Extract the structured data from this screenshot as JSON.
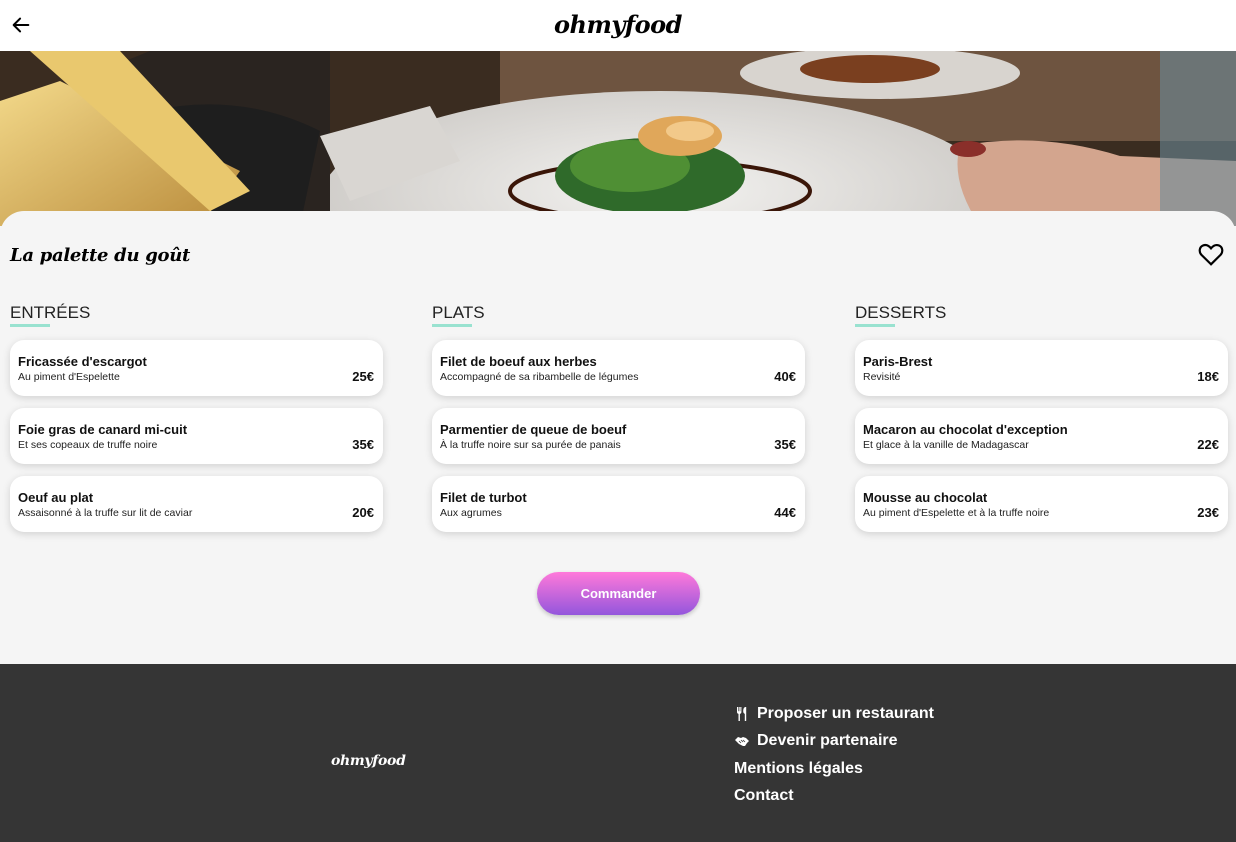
{
  "header": {
    "logo": "ohmyfood"
  },
  "restaurant": {
    "name": "La palette du goût"
  },
  "menu": [
    {
      "title": "ENTRÉES",
      "items": [
        {
          "name": "Fricassée d'escargot",
          "desc": "Au piment d'Espelette",
          "price": "25€"
        },
        {
          "name": "Foie gras de canard mi-cuit",
          "desc": "Et ses copeaux de truffe noire",
          "price": "35€"
        },
        {
          "name": "Oeuf au plat",
          "desc": "Assaisonné à la truffe sur lit de caviar",
          "price": "20€"
        }
      ]
    },
    {
      "title": "PLATS",
      "items": [
        {
          "name": "Filet de boeuf aux herbes",
          "desc": "Accompagné de sa ribambelle de légumes",
          "price": "40€"
        },
        {
          "name": "Parmentier de queue de boeuf",
          "desc": "À la truffe noire sur sa purée de panais",
          "price": "35€"
        },
        {
          "name": "Filet de turbot",
          "desc": "Aux agrumes",
          "price": "44€"
        }
      ]
    },
    {
      "title": "DESSERTS",
      "items": [
        {
          "name": "Paris-Brest",
          "desc": "Revisité",
          "price": "18€"
        },
        {
          "name": "Macaron au chocolat d'exception",
          "desc": "Et glace à la vanille de Madagascar",
          "price": "22€"
        },
        {
          "name": "Mousse au chocolat",
          "desc": "Au piment d'Espelette et à la truffe noire",
          "price": "23€"
        }
      ]
    }
  ],
  "order_button": "Commander",
  "footer": {
    "logo": "ohmyfood",
    "links": [
      {
        "label": "Proposer un restaurant",
        "icon": "utensils-icon"
      },
      {
        "label": "Devenir partenaire",
        "icon": "handshake-icon"
      },
      {
        "label": "Mentions légales",
        "icon": ""
      },
      {
        "label": "Contact",
        "icon": ""
      }
    ]
  },
  "colors": {
    "accent_underline": "#99e2d0",
    "button_gradient_top": "#ff79da",
    "button_gradient_bottom": "#9356dc",
    "footer_bg": "#353535",
    "page_bg": "#f5f5f5"
  }
}
